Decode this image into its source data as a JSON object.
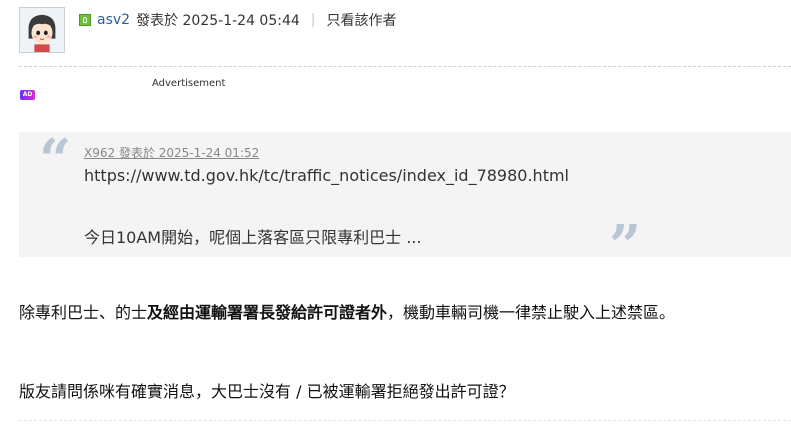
{
  "post": {
    "author": "asv2",
    "posted_at": "發表於 2025-1-24 05:44",
    "separator": "|",
    "view_author_only": "只看該作者",
    "online_icon": "online-status-icon",
    "avatar_icon": "avatar-girl-icon"
  },
  "ad": {
    "label": "Advertisement",
    "badge": "AD"
  },
  "quote": {
    "meta": "X962 發表於 2025-1-24 01:52",
    "url": "https://www.td.gov.hk/tc/traffic_notices/index_id_78980.html",
    "text": "今日10AM開始，呢個上落客區只限專利巴士 ...",
    "open_mark": "“",
    "close_mark": "”"
  },
  "body": {
    "p1_part1": "除專利巴士、的士",
    "p1_bold": "及經由運輸署署長發給許可證者外",
    "p1_part2": "，機動車輛司機一律禁止駛入上述禁區。",
    "p2": "版友請問係咪有確實消息，大巴士沒有 / 已被運輸署拒絕發出許可證？"
  },
  "colors": {
    "author_link": "#2d5f9a",
    "quote_bg": "#f4f4f4",
    "quote_mark": "#b9c6d4"
  }
}
